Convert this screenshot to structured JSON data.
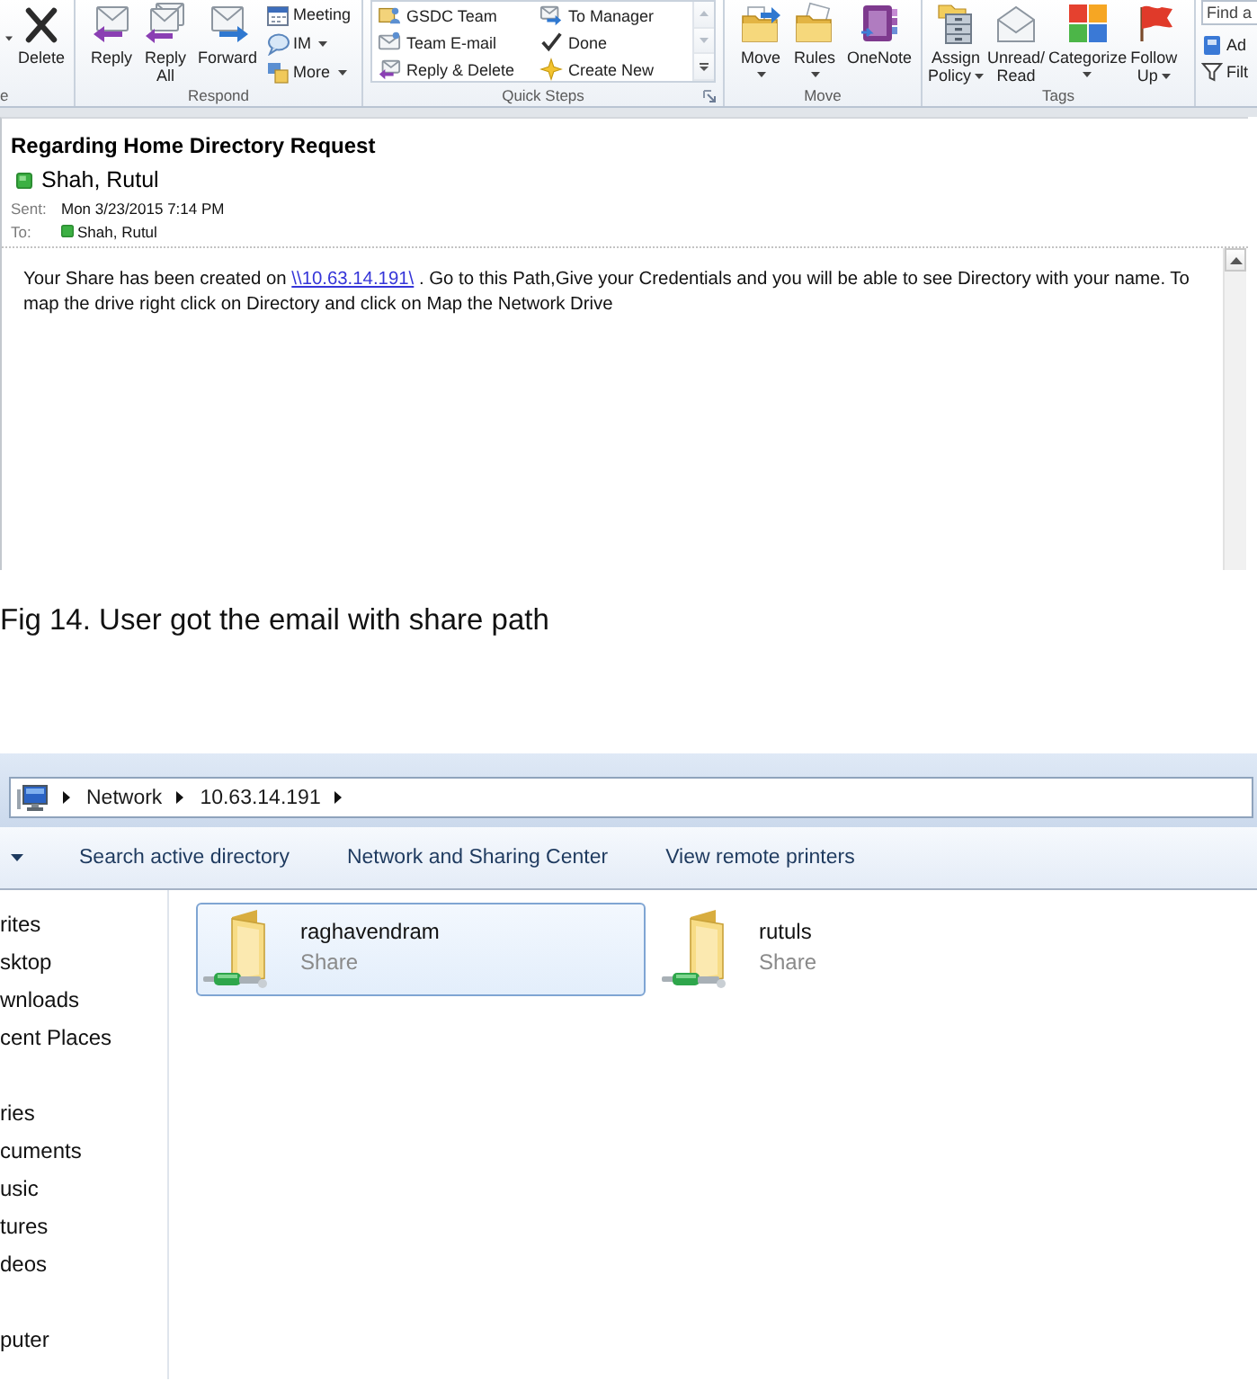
{
  "ribbon": {
    "groups": [
      {
        "kind": "actions",
        "label": "e",
        "large": [
          {
            "label": "Delete",
            "menu": false
          }
        ]
      },
      {
        "kind": "actions",
        "label": "Respond",
        "large": [
          {
            "label": "Reply",
            "menu": false
          },
          {
            "label": "Reply All",
            "menu": false
          },
          {
            "label": "Forward",
            "menu": false
          }
        ],
        "small": [
          {
            "label": "Meeting",
            "menu": false
          },
          {
            "label": "IM",
            "menu": true
          },
          {
            "label": "More",
            "menu": true
          }
        ]
      },
      {
        "kind": "gallery",
        "label": "Quick Steps",
        "items": [
          {
            "label": "GSDC Team"
          },
          {
            "label": "To Manager"
          },
          {
            "label": "Team E-mail"
          },
          {
            "label": "Done"
          },
          {
            "label": "Reply & Delete"
          },
          {
            "label": "Create New"
          }
        ]
      },
      {
        "kind": "actions",
        "label": "Move",
        "large": [
          {
            "label": "Move",
            "menu": true
          },
          {
            "label": "Rules",
            "menu": true
          },
          {
            "label": "OneNote",
            "menu": false
          }
        ]
      },
      {
        "kind": "actions",
        "label": "Tags",
        "large": [
          {
            "label": "Assign Policy",
            "menu": true
          },
          {
            "label": "Unread/ Read",
            "menu": false
          },
          {
            "label": "Categorize",
            "menu": true
          },
          {
            "label": "Follow Up",
            "menu": true
          }
        ]
      },
      {
        "kind": "find",
        "search": {
          "placeholder": "Find a"
        },
        "small": [
          {
            "label": "Ad",
            "menu": false
          },
          {
            "label": "Filt",
            "menu": false
          }
        ]
      }
    ]
  },
  "message": {
    "subject": "Regarding Home Directory Request",
    "sender": "Shah, Rutul",
    "sent_label": "Sent:",
    "sent": "Mon 3/23/2015 7:14 PM",
    "to_label": "To:",
    "to": "Shah, Rutul",
    "body": {
      "before": "Your Share has been created on ",
      "link": "\\\\10.63.14.191\\",
      "after": " . Go to this Path,Give your Credentials and you will be able to see Directory with your name. To map the drive right click on Directory and click on Map the Network Drive"
    }
  },
  "caption": "Fig 14. User got the email with share path",
  "explorer": {
    "breadcrumb": [
      "Network",
      "10.63.14.191"
    ],
    "toolbar": [
      "Search active directory",
      "Network and Sharing Center",
      "View remote printers"
    ],
    "navigation": [
      {
        "label": "rites",
        "children": [
          {
            "label": "sktop"
          },
          {
            "label": "wnloads"
          },
          {
            "label": "cent Places"
          }
        ]
      },
      {
        "label": "ries",
        "children": [
          {
            "label": "cuments"
          },
          {
            "label": "usic"
          },
          {
            "label": "tures"
          },
          {
            "label": "deos"
          }
        ]
      },
      {
        "label": "puter"
      }
    ],
    "items": [
      {
        "name": "raghavendram",
        "type": "Share",
        "selected": true
      },
      {
        "name": "rutuls",
        "type": "Share",
        "selected": false
      }
    ]
  }
}
